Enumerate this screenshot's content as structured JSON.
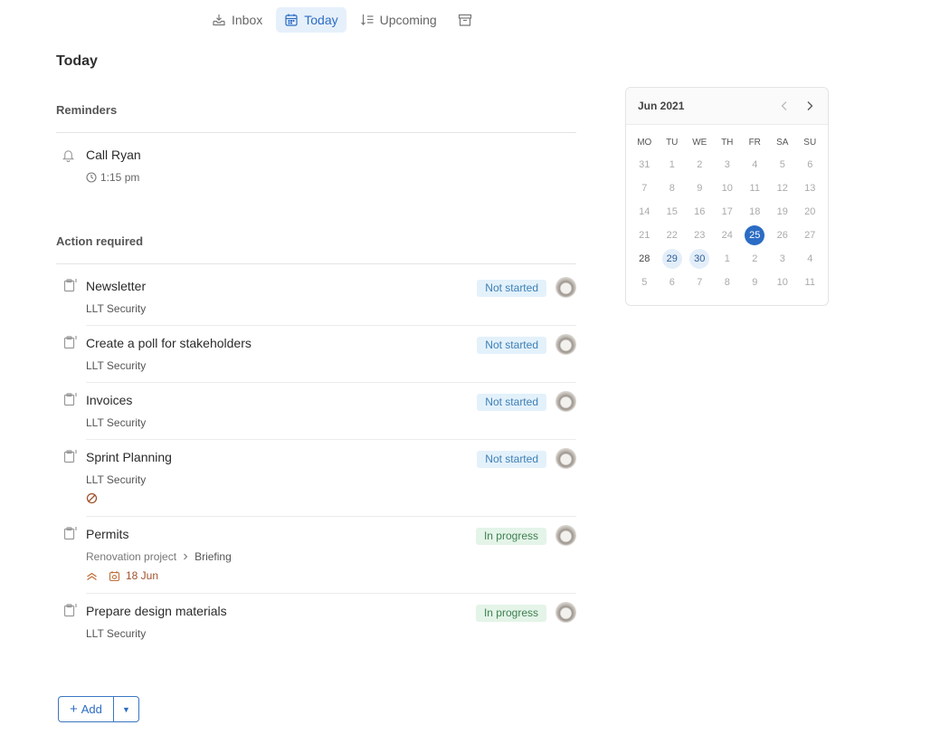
{
  "nav": {
    "tabs": [
      {
        "label": "Inbox",
        "icon": "inbox-icon"
      },
      {
        "label": "Today",
        "icon": "calendar-icon"
      },
      {
        "label": "Upcoming",
        "icon": "sort-icon"
      }
    ],
    "archive_icon": "archive-icon"
  },
  "page_title": "Today",
  "reminders": {
    "title": "Reminders",
    "items": [
      {
        "title": "Call Ryan",
        "time": "1:15 pm"
      }
    ]
  },
  "action_required": {
    "title": "Action required",
    "tasks": [
      {
        "title": "Newsletter",
        "sub": "LLT Security",
        "status": "Not started"
      },
      {
        "title": "Create a poll for stakeholders",
        "sub": "LLT Security",
        "status": "Not started"
      },
      {
        "title": "Invoices",
        "sub": "LLT Security",
        "status": "Not started"
      },
      {
        "title": "Sprint Planning",
        "sub": "LLT Security",
        "status": "Not started"
      },
      {
        "title": "Permits",
        "sub_project": "Renovation project",
        "sub_section": "Briefing",
        "due": "18 Jun",
        "status": "In progress"
      },
      {
        "title": "Prepare design materials",
        "sub": "LLT Security",
        "status": "In progress"
      }
    ]
  },
  "add": {
    "label": "Add"
  },
  "calendar": {
    "month": "Jun 2021",
    "dow": [
      "MO",
      "TU",
      "WE",
      "TH",
      "FR",
      "SA",
      "SU"
    ],
    "weeks": [
      [
        "31",
        "1",
        "2",
        "3",
        "4",
        "5",
        "6"
      ],
      [
        "7",
        "8",
        "9",
        "10",
        "11",
        "12",
        "13"
      ],
      [
        "14",
        "15",
        "16",
        "17",
        "18",
        "19",
        "20"
      ],
      [
        "21",
        "22",
        "23",
        "24",
        "25",
        "26",
        "27"
      ],
      [
        "28",
        "29",
        "30",
        "1",
        "2",
        "3",
        "4"
      ],
      [
        "5",
        "6",
        "7",
        "8",
        "9",
        "10",
        "11"
      ]
    ],
    "today": "25",
    "highlighted": [
      "29",
      "30"
    ]
  },
  "colors": {
    "accent": "#2b6cc4",
    "not_started_bg": "#e3f1fb",
    "in_progress_bg": "#e4f4e8"
  }
}
